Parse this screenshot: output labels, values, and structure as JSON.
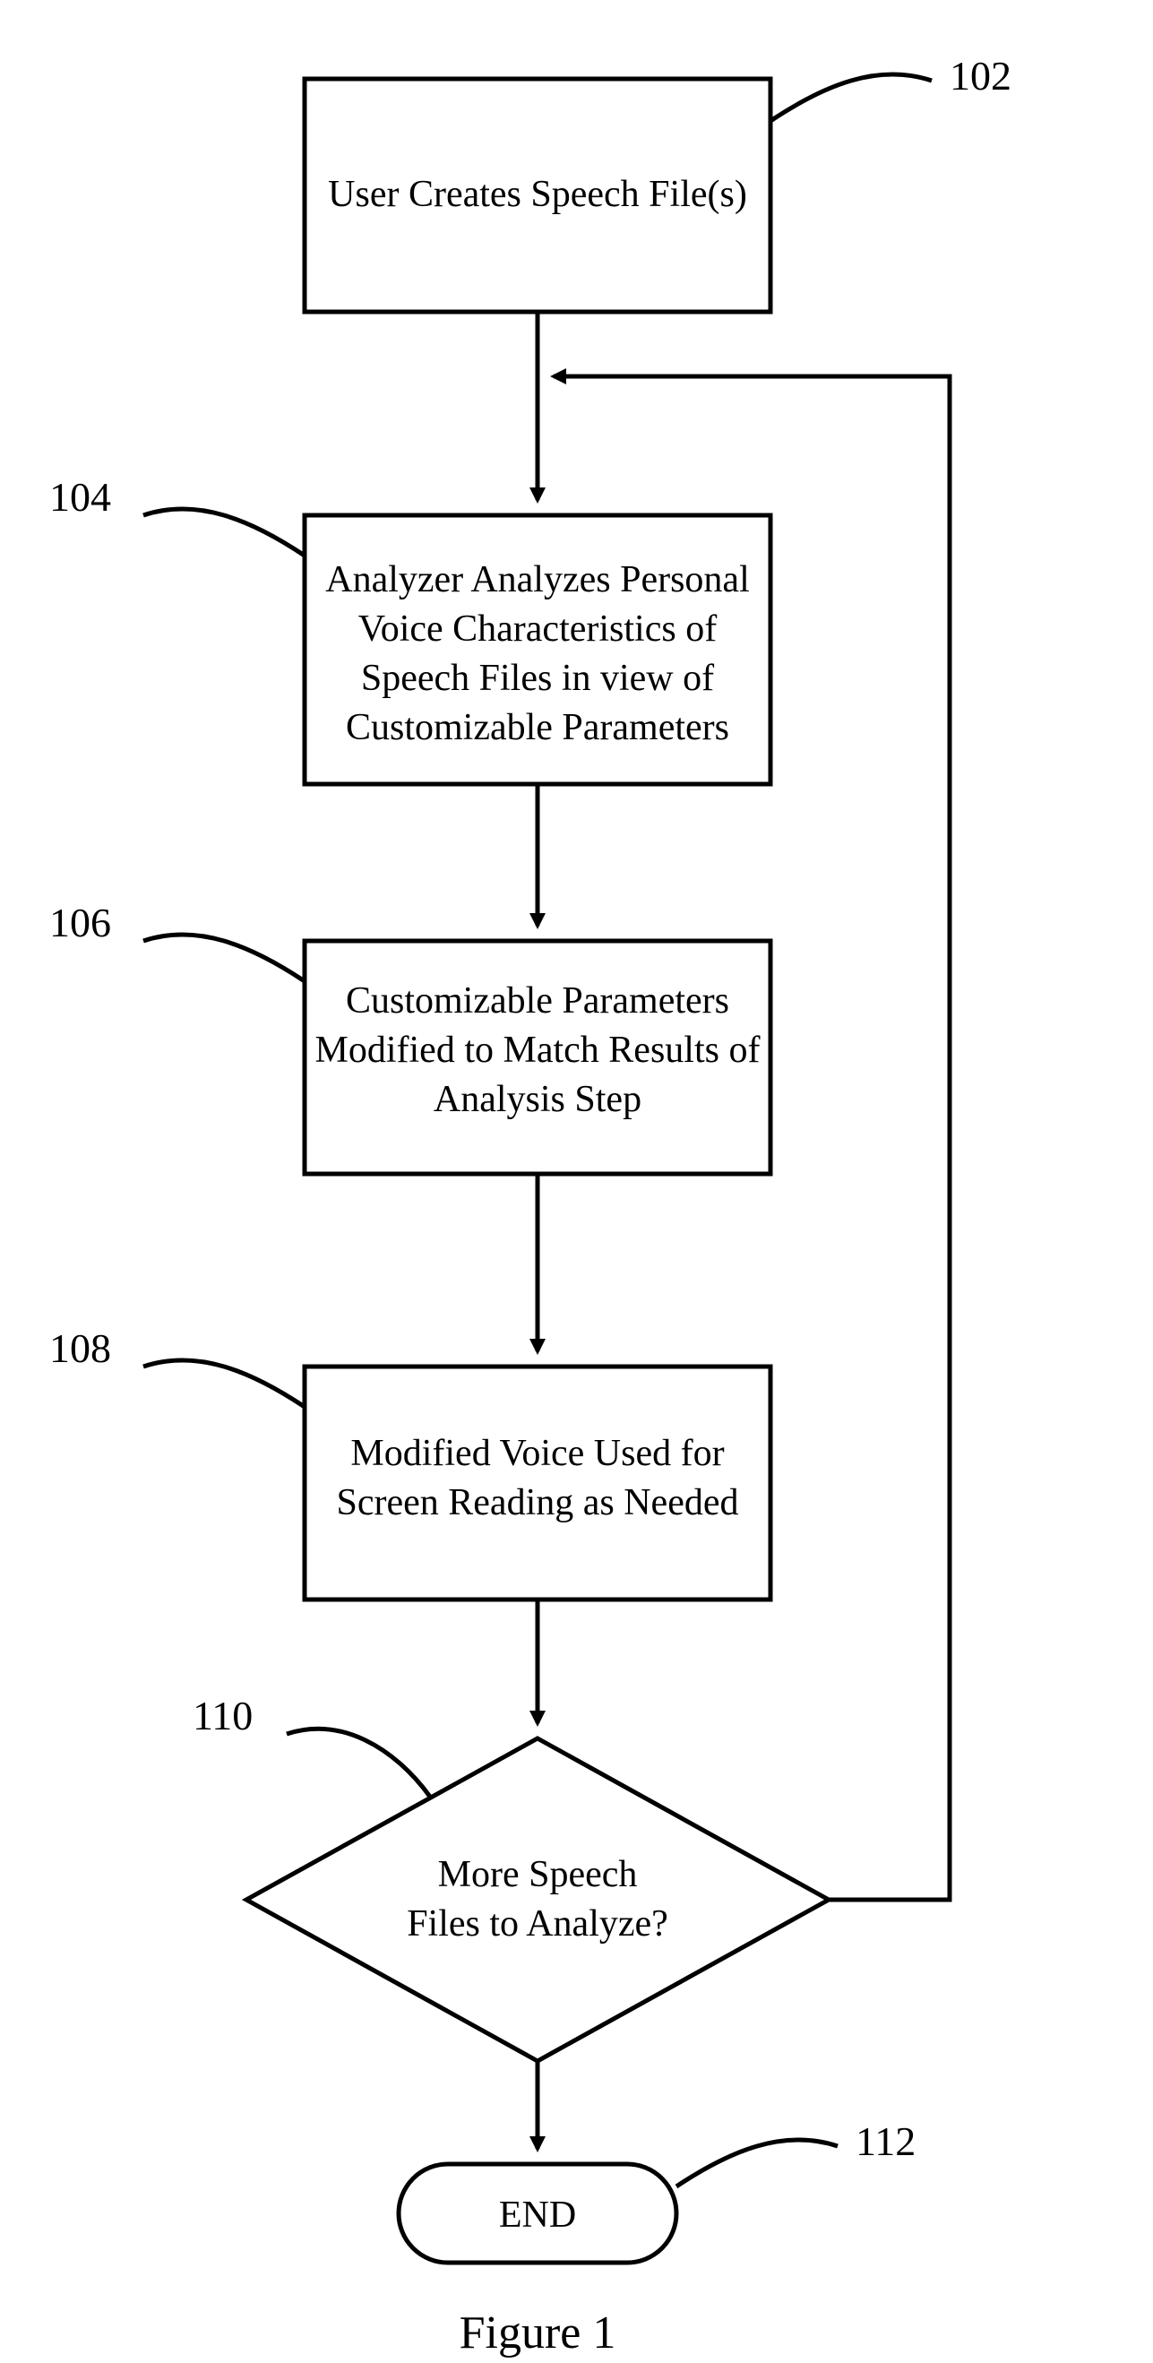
{
  "labels": {
    "n102": "102",
    "n104": "104",
    "n106": "106",
    "n108": "108",
    "n110": "110",
    "n112": "112"
  },
  "boxes": {
    "b102": "User Creates Speech File(s)",
    "b104_l1": "Analyzer Analyzes Personal",
    "b104_l2": "Voice Characteristics of",
    "b104_l3": "Speech Files in view of",
    "b104_l4": "Customizable Parameters",
    "b106_l1": "Customizable Parameters",
    "b106_l2": "Modified to Match Results of",
    "b106_l3": "Analysis Step",
    "b108_l1": "Modified Voice Used for",
    "b108_l2": "Screen Reading as Needed",
    "b110_l1": "More Speech",
    "b110_l2": "Files to Analyze?",
    "b112": "END"
  },
  "caption": "Figure 1"
}
